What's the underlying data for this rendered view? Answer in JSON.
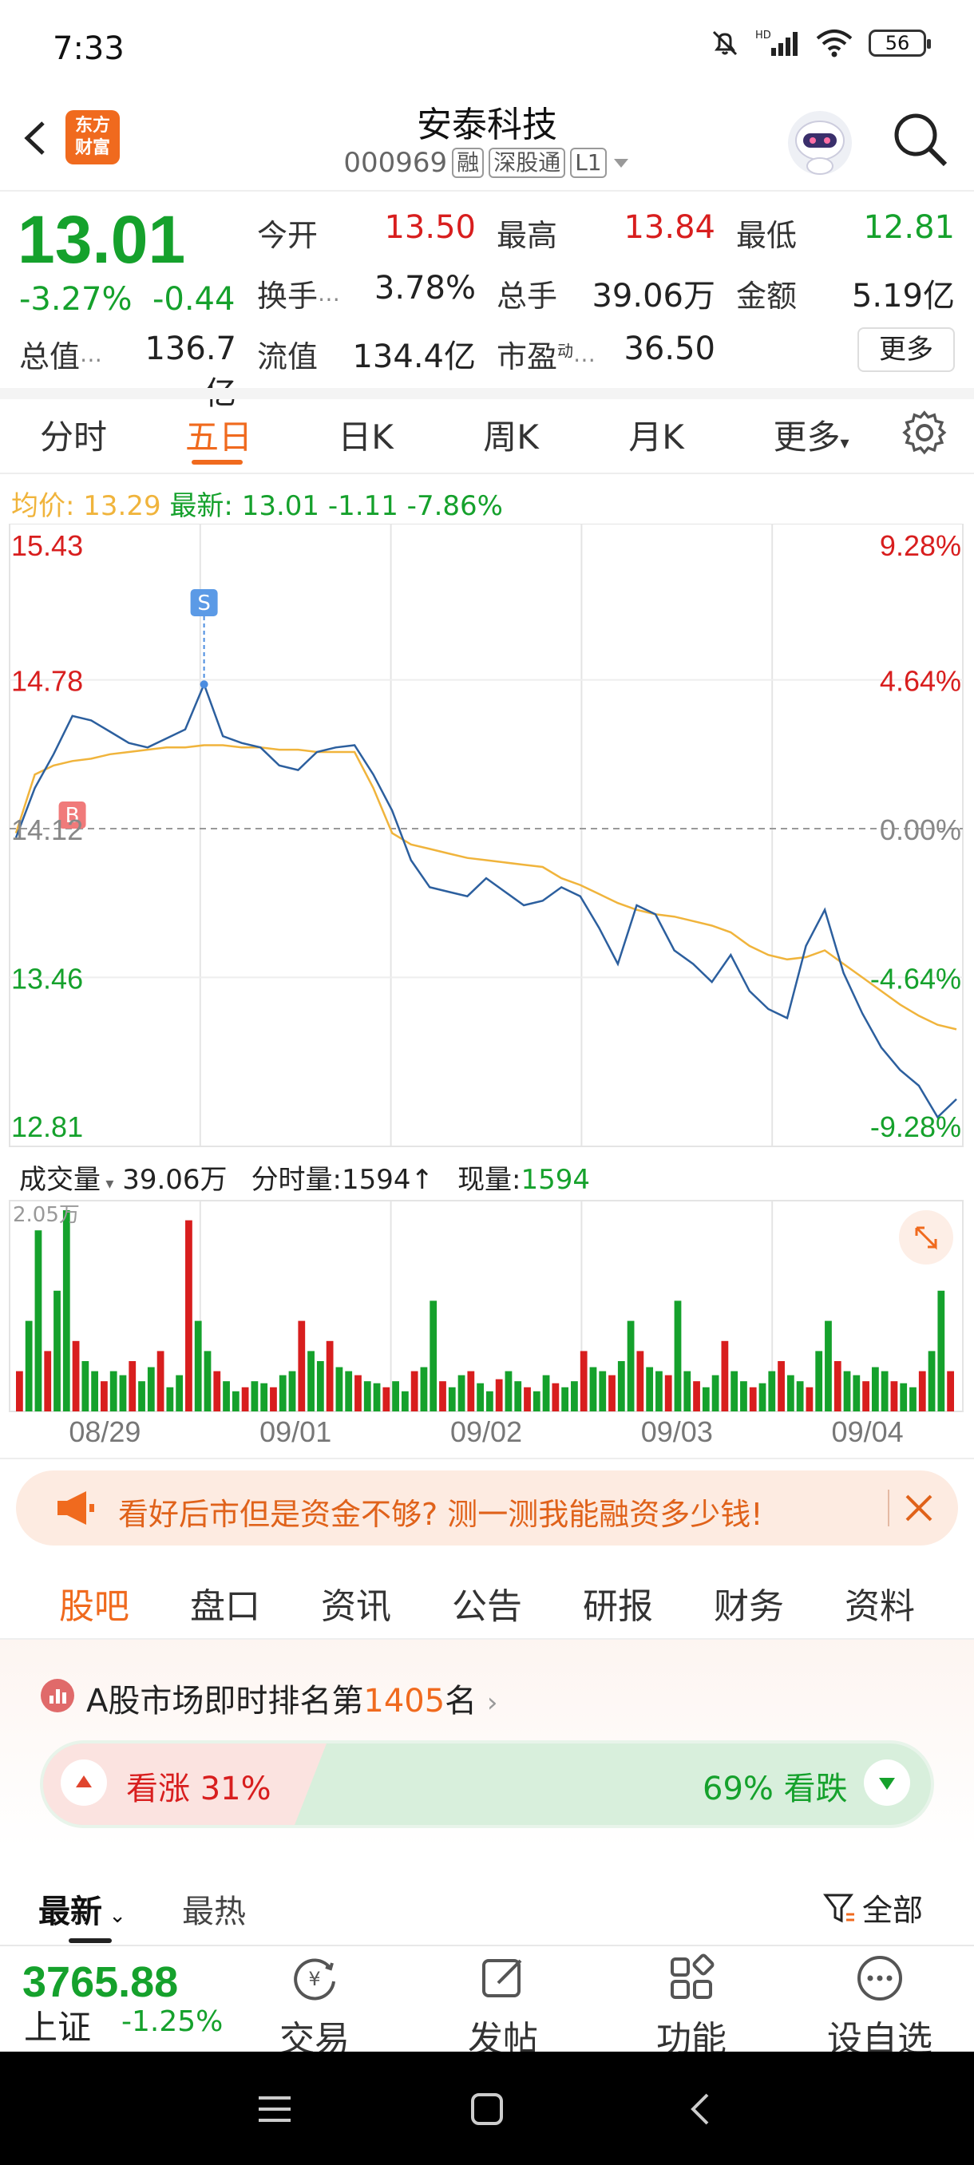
{
  "status_bar": {
    "time": "7:33",
    "network": "HD",
    "battery": "56"
  },
  "header": {
    "logo_line1": "东方",
    "logo_line2": "财富",
    "title": "安泰科技",
    "code": "000969",
    "tags": [
      "融",
      "深股通",
      "L1"
    ]
  },
  "quote": {
    "price": "13.01",
    "change_pct": "-3.27%",
    "change_abs": "-0.44",
    "fields": {
      "open_label": "今开",
      "open": "13.50",
      "high_label": "最高",
      "high": "13.84",
      "low_label": "最低",
      "low": "12.81",
      "turnover_label": "换手",
      "turnover": "3.78%",
      "volume_label": "总手",
      "volume": "39.06万",
      "amount_label": "金额",
      "amount": "5.19亿",
      "mcap_label": "总值",
      "mcap": "136.7亿",
      "float_label": "流值",
      "float": "134.4亿",
      "pe_label": "市盈",
      "pe_sup": "动",
      "pe": "36.50"
    },
    "more_label": "更多"
  },
  "period_tabs": [
    "分时",
    "五日",
    "日K",
    "周K",
    "月K",
    "更多"
  ],
  "active_period": "五日",
  "chart_legend": {
    "avg_label": "均价:",
    "avg": "13.29",
    "latest_label": "最新:",
    "latest": "13.01",
    "chg": "-1.11",
    "chg_pct": "-7.86%"
  },
  "chart_data": {
    "type": "line",
    "y_labels_left": [
      "15.43",
      "14.78",
      "14.12",
      "13.46",
      "12.81"
    ],
    "y_labels_right": [
      "9.28%",
      "4.64%",
      "0.00%",
      "-4.64%",
      "-9.28%"
    ],
    "ylim": [
      12.81,
      15.43
    ],
    "prev_close": 14.12,
    "days": [
      "08/29",
      "09/01",
      "09/02",
      "09/03",
      "09/04"
    ],
    "markers": [
      {
        "label": "B"
      },
      {
        "label": "S"
      }
    ],
    "series": [
      {
        "name": "价格",
        "values": [
          14.08,
          14.3,
          14.45,
          14.62,
          14.6,
          14.55,
          14.5,
          14.48,
          14.52,
          14.56,
          14.76,
          14.53,
          14.5,
          14.48,
          14.4,
          14.38,
          14.46,
          14.48,
          14.49,
          14.36,
          14.2,
          13.98,
          13.86,
          13.84,
          13.82,
          13.9,
          13.84,
          13.78,
          13.8,
          13.86,
          13.82,
          13.68,
          13.52,
          13.78,
          13.74,
          13.58,
          13.52,
          13.44,
          13.56,
          13.4,
          13.32,
          13.28,
          13.6,
          13.76,
          13.48,
          13.3,
          13.15,
          13.05,
          12.98,
          12.84,
          12.92
        ]
      },
      {
        "name": "均价",
        "values": [
          14.1,
          14.36,
          14.4,
          14.42,
          14.43,
          14.45,
          14.46,
          14.47,
          14.48,
          14.48,
          14.49,
          14.49,
          14.48,
          14.48,
          14.47,
          14.47,
          14.46,
          14.46,
          14.46,
          14.3,
          14.1,
          14.05,
          14.03,
          14.01,
          13.99,
          13.98,
          13.97,
          13.96,
          13.95,
          13.9,
          13.87,
          13.83,
          13.79,
          13.76,
          13.74,
          13.73,
          13.71,
          13.69,
          13.66,
          13.6,
          13.56,
          13.54,
          13.55,
          13.58,
          13.52,
          13.46,
          13.4,
          13.34,
          13.29,
          13.25,
          13.23
        ]
      }
    ]
  },
  "volume_bar": {
    "label": "成交量",
    "total": "39.06万",
    "minute_label": "分时量:",
    "minute": "1594",
    "now_label": "现量:",
    "now": "1594",
    "max": "2.05万"
  },
  "volume_data": {
    "type": "bar",
    "values": [
      0.2,
      0.45,
      0.9,
      0.3,
      0.6,
      1.0,
      0.35,
      0.25,
      0.2,
      0.15,
      0.2,
      0.18,
      0.25,
      0.15,
      0.22,
      0.3,
      0.12,
      0.18,
      0.95,
      0.45,
      0.3,
      0.2,
      0.15,
      0.1,
      0.12,
      0.15,
      0.14,
      0.12,
      0.18,
      0.2,
      0.45,
      0.3,
      0.25,
      0.35,
      0.22,
      0.2,
      0.18,
      0.15,
      0.14,
      0.12,
      0.15,
      0.1,
      0.2,
      0.22,
      0.55,
      0.15,
      0.12,
      0.18,
      0.2,
      0.14,
      0.1,
      0.16,
      0.2,
      0.15,
      0.12,
      0.1,
      0.18,
      0.14,
      0.12,
      0.15,
      0.3,
      0.22,
      0.2,
      0.18,
      0.25,
      0.45,
      0.3,
      0.22,
      0.2,
      0.18,
      0.55,
      0.2,
      0.15,
      0.12,
      0.18,
      0.35,
      0.2,
      0.15,
      0.12,
      0.14,
      0.2,
      0.25,
      0.18,
      0.15,
      0.12,
      0.3,
      0.45,
      0.25,
      0.2,
      0.18,
      0.15,
      0.22,
      0.2,
      0.15,
      0.14,
      0.12,
      0.2,
      0.3,
      0.6,
      0.2
    ],
    "colors": [
      "#d81e1e",
      "#15a12c"
    ]
  },
  "banner": {
    "text": "看好后市但是资金不够? 测一测我能融资多少钱!"
  },
  "content_tabs": [
    "股吧",
    "盘口",
    "资讯",
    "公告",
    "研报",
    "财务",
    "资料"
  ],
  "active_content_tab": "股吧",
  "ranking": {
    "prefix": "A股市场即时排名第",
    "rank": "1405",
    "suffix": "名"
  },
  "vote": {
    "up_label": "看涨",
    "up_pct": "31%",
    "down_pct": "69%",
    "down_label": "看跌",
    "up_frac": 0.31
  },
  "feed_tabs": {
    "latest": "最新",
    "hot": "最热",
    "filter": "全部"
  },
  "index_ticker": {
    "value": "3765.88",
    "name": "上证",
    "change": "-1.25%"
  },
  "bottom_nav": [
    "交易",
    "发帖",
    "功能",
    "设自选"
  ],
  "colors": {
    "red": "#d81e1e",
    "green": "#15a12c",
    "accent": "#f06a1e",
    "avg_line": "#f0b43c",
    "price_line": "#2c5f9e"
  }
}
